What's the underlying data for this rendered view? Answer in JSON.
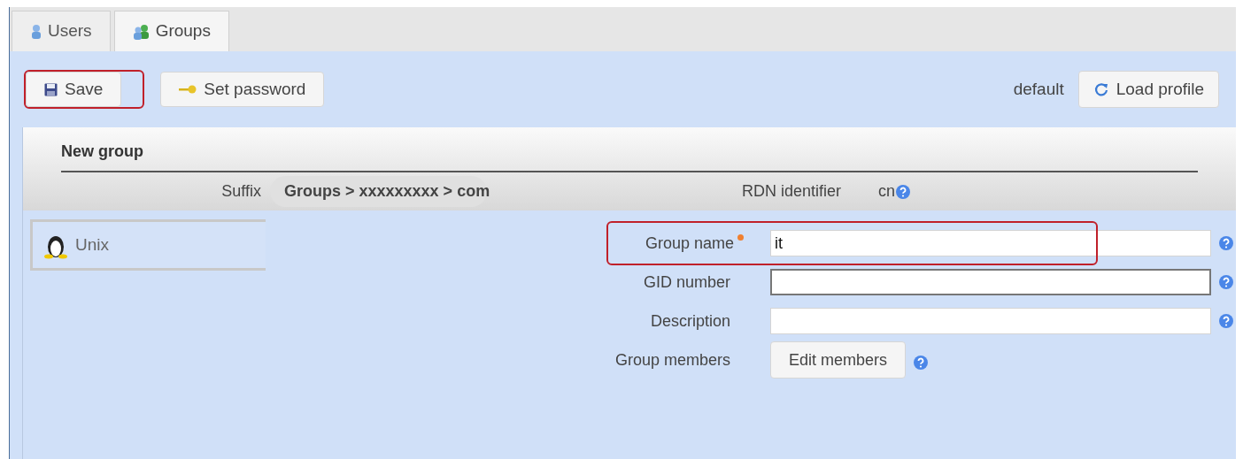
{
  "tabs": [
    {
      "label": "Users",
      "kind": "user",
      "selected": false
    },
    {
      "label": "Groups",
      "kind": "group",
      "selected": true
    }
  ],
  "toolbar": {
    "buttons": [
      {
        "label": "Save",
        "kind": "save",
        "highlighted": true
      },
      {
        "label": "Set password",
        "kind": "key",
        "highlighted": false
      }
    ],
    "profile": {
      "name": "default",
      "button": "Load profile"
    }
  },
  "panel": {
    "title": "New group",
    "suffix_label": "Suffix",
    "suffix_value": "Groups > xxxxxxxxx > com",
    "rdn_label": "RDN identifier",
    "rdn_value": "cn"
  },
  "modules": [
    {
      "label": "Unix",
      "selected": true
    }
  ],
  "fields": [
    {
      "kind": "input",
      "label": "Group name",
      "required": true,
      "value": "it",
      "focused": false,
      "highlighted": true
    },
    {
      "kind": "input",
      "label": "GID number",
      "required": false,
      "focused": true,
      "highlighted": false
    },
    {
      "kind": "input",
      "label": "Description",
      "required": false,
      "focused": false,
      "highlighted": false
    },
    {
      "kind": "button",
      "label": "Group members",
      "button": "Edit members",
      "highlighted": false
    }
  ]
}
